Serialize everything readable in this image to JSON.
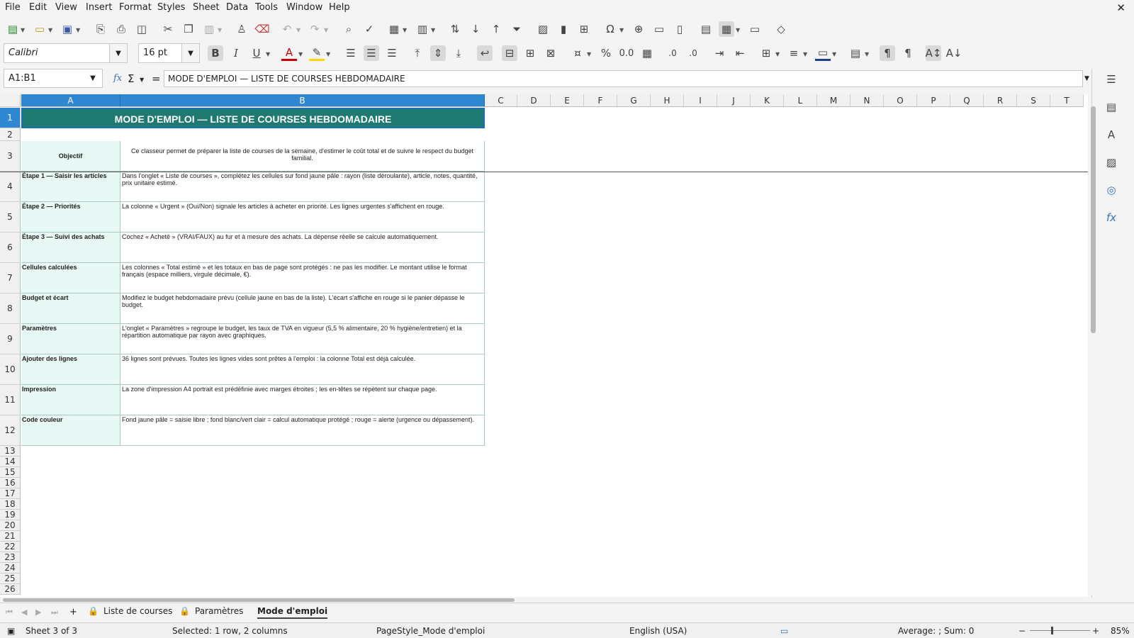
{
  "menu": [
    "File",
    "Edit",
    "View",
    "Insert",
    "Format",
    "Styles",
    "Sheet",
    "Data",
    "Tools",
    "Window",
    "Help"
  ],
  "font": {
    "name": "Calibri",
    "size": "16 pt"
  },
  "formula_bar": {
    "cell_ref": "A1:B1",
    "fx_symbol": "fx",
    "sigma_symbol": "Σ",
    "equals_symbol": "=",
    "content": "MODE D'EMPLOI — LISTE DE COURSES HEBDOMADAIRE"
  },
  "columns": [
    "A",
    "B",
    "C",
    "D",
    "E",
    "F",
    "G",
    "H",
    "I",
    "J",
    "K",
    "L",
    "M",
    "N",
    "O",
    "P",
    "Q",
    "R",
    "S",
    "T"
  ],
  "rows_numbers": [
    "1",
    "2",
    "3",
    "4",
    "5",
    "6",
    "7",
    "8",
    "9",
    "10",
    "11",
    "12",
    "13",
    "14",
    "15",
    "16",
    "17",
    "18",
    "19",
    "20",
    "21",
    "22",
    "23",
    "24",
    "25",
    "26"
  ],
  "sheet": {
    "title": "MODE D'EMPLOI — LISTE DE COURSES HEBDOMADAIRE",
    "objective_label": "Objectif",
    "objective_text": "Ce classeur permet de préparer la liste de courses de la semaine, d'estimer le coût total et de suivre le respect du budget familial.",
    "rows": [
      {
        "label": "Étape 1 — Saisir les articles",
        "text": "Dans l'onglet « Liste de courses », complétez les cellules sur fond jaune pâle : rayon (liste déroulante), article, notes, quantité, prix unitaire estimé."
      },
      {
        "label": "Étape 2 — Priorités",
        "text": "La colonne « Urgent » (Oui/Non) signale les articles à acheter en priorité. Les lignes urgentes s'affichent en rouge."
      },
      {
        "label": "Étape 3 — Suivi des achats",
        "text": "Cochez « Acheté » (VRAI/FAUX) au fur et à mesure des achats. La dépense réelle se calcule automatiquement."
      },
      {
        "label": "Cellules calculées",
        "text": "Les colonnes « Total estimé » et les totaux en bas de page sont protégés : ne pas les modifier. Le montant utilise le format français (espace milliers, virgule décimale, €)."
      },
      {
        "label": "Budget et écart",
        "text": "Modifiez le budget hebdomadaire prévu (cellule jaune en bas de la liste). L'écart s'affiche en rouge si le panier dépasse le budget."
      },
      {
        "label": "Paramètres",
        "text": "L'onglet « Paramètres » regroupe le budget, les taux de TVA en vigueur (5,5 % alimentaire, 20 % hygiène/entretien) et la répartition automatique par rayon avec graphiques."
      },
      {
        "label": "Ajouter des lignes",
        "text": "36 lignes sont prévues. Toutes les lignes vides sont prêtes à l'emploi : la colonne Total est déjà calculée."
      },
      {
        "label": "Impression",
        "text": "La zone d'impression A4 portrait est prédéfinie avec marges étroites ; les en-têtes se répètent sur chaque page."
      },
      {
        "label": "Code couleur",
        "text": "Fond jaune pâle = saisie libre ; fond blanc/vert clair = calcul automatique protégé ; rouge = alerte (urgence ou dépassement)."
      }
    ]
  },
  "tabs": [
    {
      "label": "Liste de courses",
      "active": false
    },
    {
      "label": "Paramètres",
      "active": false
    },
    {
      "label": "Mode d'emploi",
      "active": true
    }
  ],
  "status": {
    "sheet": "Sheet 3 of 3",
    "selection": "Selected: 1 row, 2 columns",
    "page_style": "PageStyle_Mode d'emploi",
    "language": "English (USA)",
    "summary": "Average: ; Sum: 0",
    "zoom": "85%"
  },
  "icons": {
    "close": "close-icon",
    "toolbar1": [
      "new-icon",
      "open-icon",
      "save-icon",
      "export-pdf-icon",
      "print-icon",
      "print-preview-icon",
      "cut-icon",
      "copy-icon",
      "paste-icon",
      "clone-format-icon",
      "clear-format-icon",
      "undo-icon",
      "redo-icon",
      "find-replace-icon",
      "spellcheck-icon",
      "row-icon",
      "column-icon",
      "sort-icon",
      "sort-ascending-icon",
      "sort-descending-icon",
      "autofilter-icon",
      "image-icon",
      "chart-icon",
      "pivot-table-icon",
      "special-character-icon",
      "hyperlink-icon",
      "comment-icon",
      "header-footer-icon",
      "define-print-area-icon",
      "freeze-icon",
      "split-window-icon",
      "draw-functions-icon"
    ],
    "toolbar2": [
      "bold-icon",
      "italic-icon",
      "underline-icon",
      "font-color-icon",
      "highlight-icon",
      "align-left-icon",
      "align-center-icon",
      "align-right-icon",
      "align-top-icon",
      "align-middle-icon",
      "align-bottom-icon",
      "wrap-text-icon",
      "merge-center-icon",
      "merge-icon",
      "unmerge-icon",
      "currency-icon",
      "percent-icon",
      "number-icon",
      "date-icon",
      "add-decimal-icon",
      "delete-decimal-icon",
      "increase-indent-icon",
      "decrease-indent-icon",
      "borders-icon",
      "border-style-icon",
      "border-color-icon",
      "conditional-format-icon",
      "ltr-icon",
      "rtl-icon",
      "text-direction-icon",
      "vertical-text-icon"
    ],
    "sidebar": [
      "sidebar-menu-icon",
      "properties-icon",
      "styles-icon",
      "gallery-icon",
      "navigator-icon",
      "functions-icon"
    ]
  },
  "colors": {
    "title_bg": "#1f7a72",
    "label_bg": "#e8f8f5",
    "selection": "#2f86d1"
  }
}
